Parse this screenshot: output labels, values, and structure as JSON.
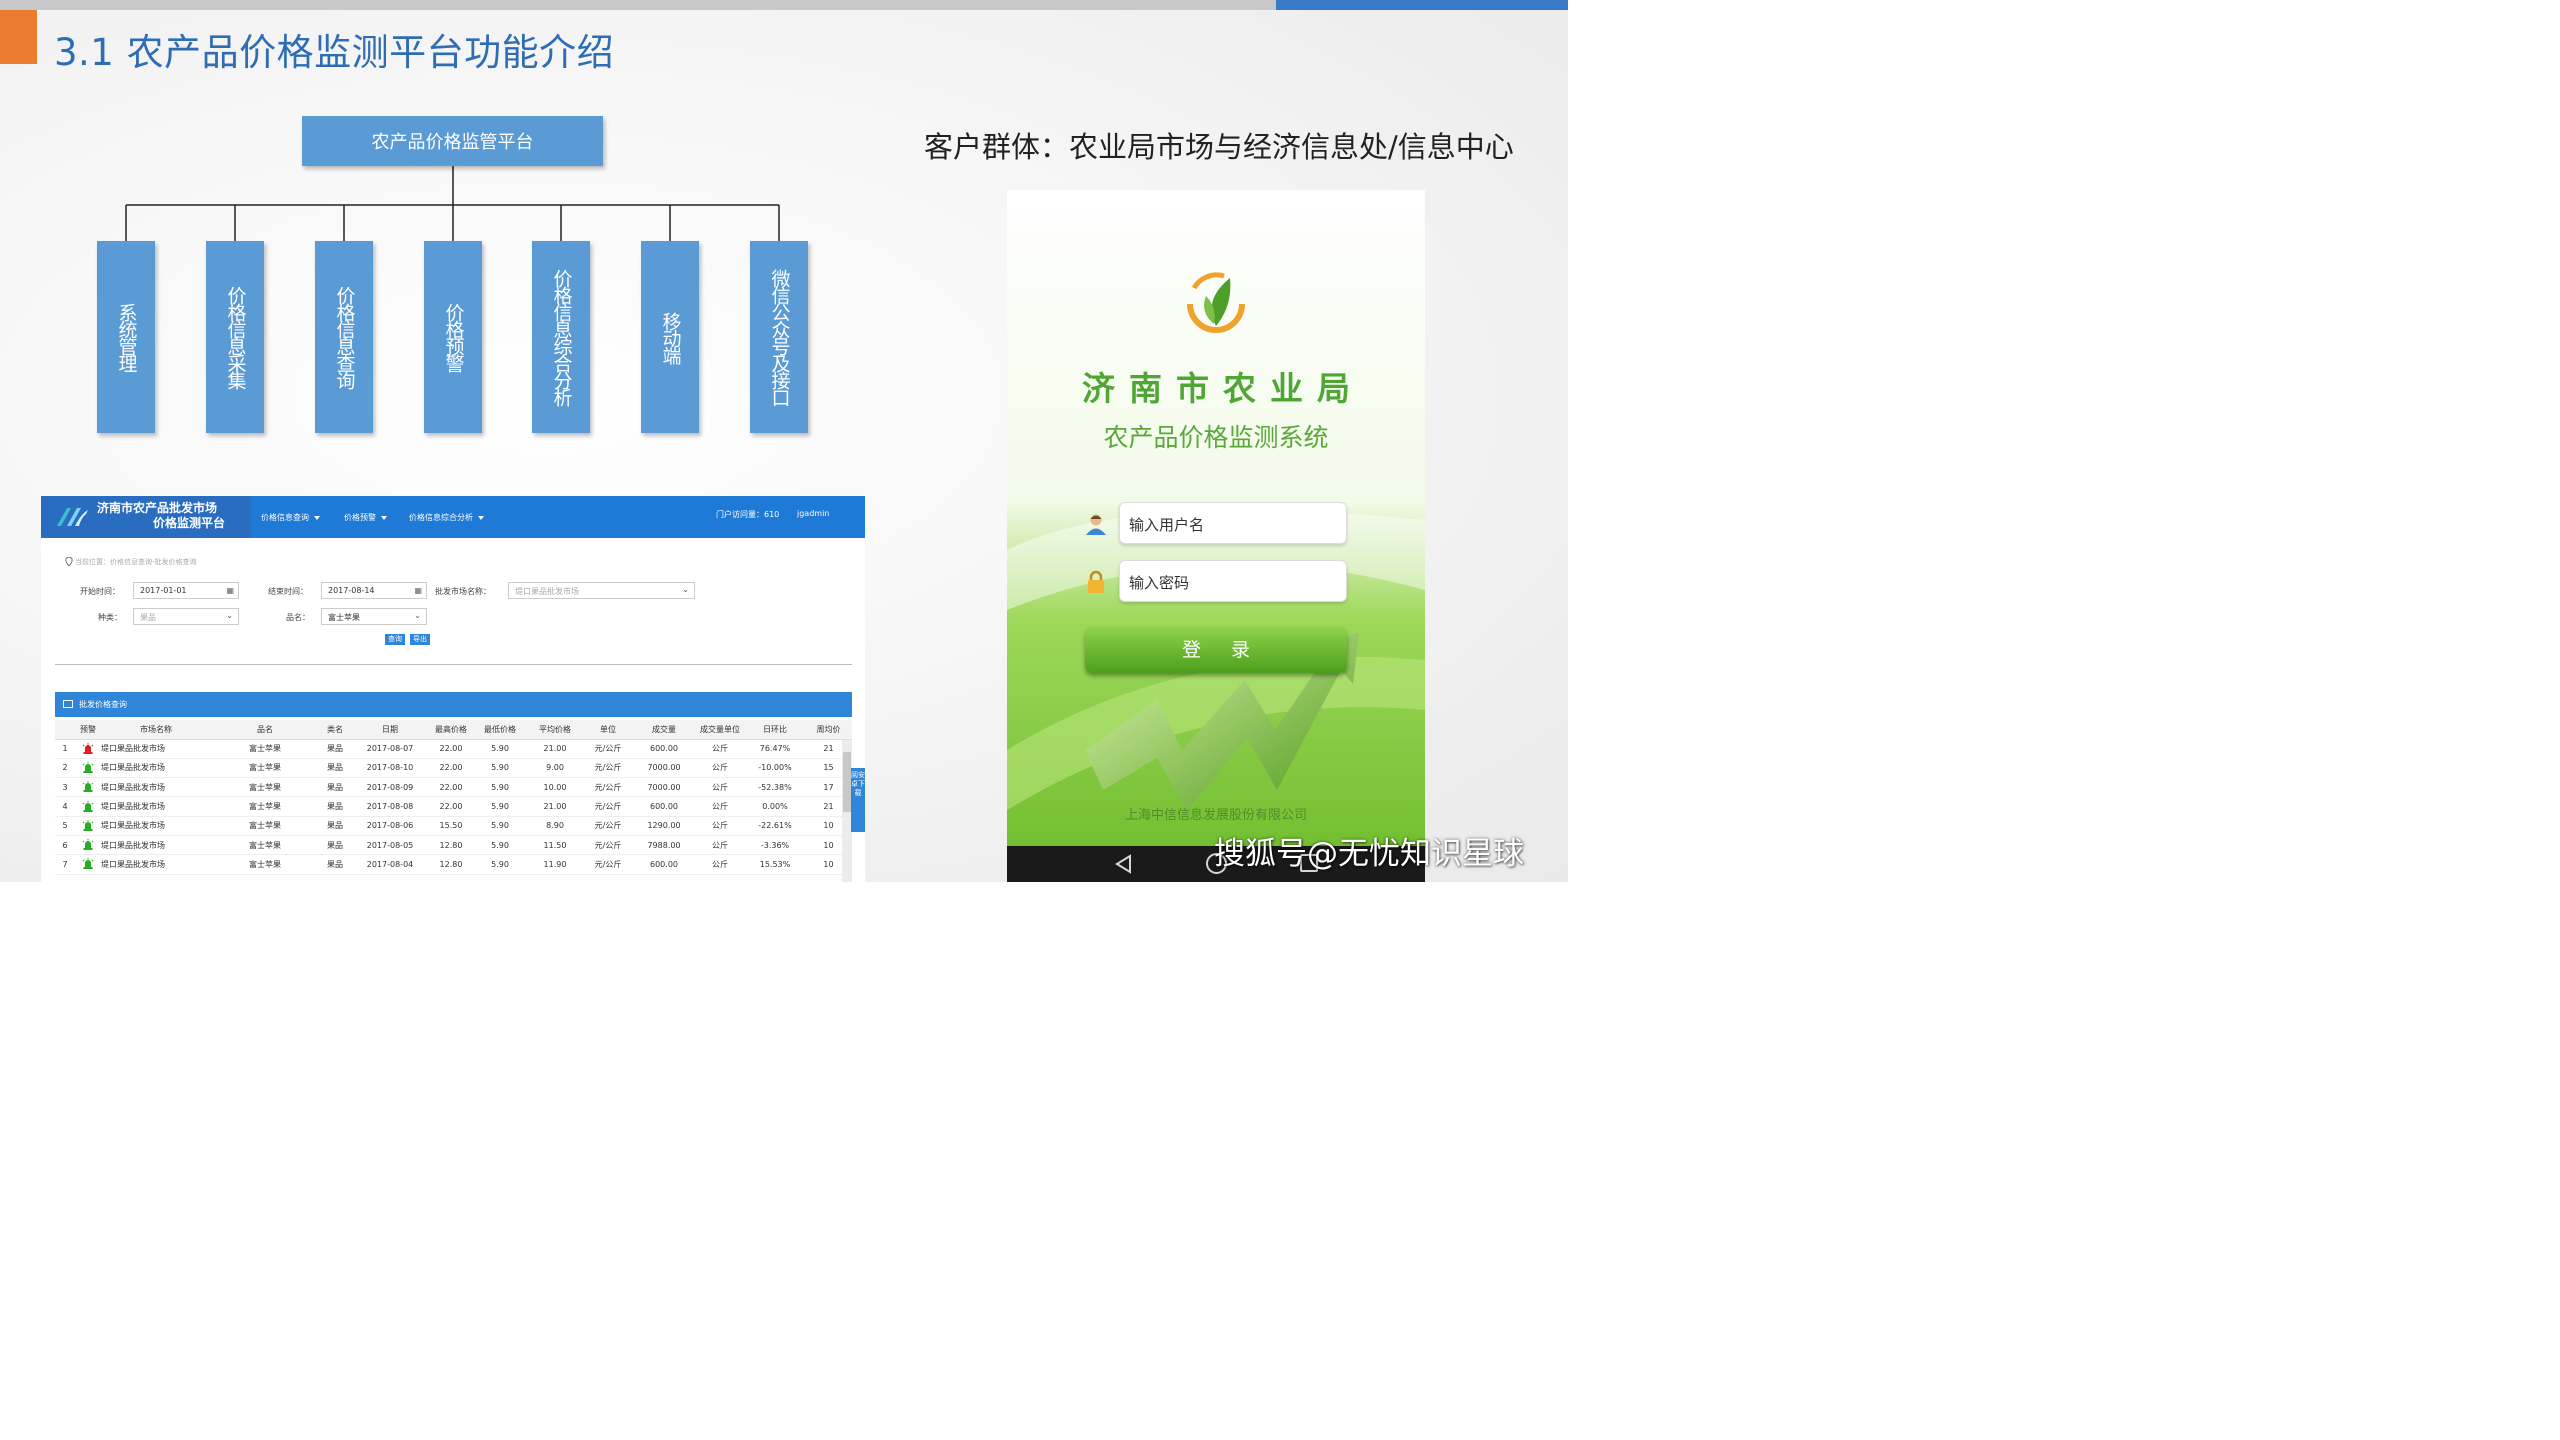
{
  "slide": {
    "title": "3.1 农产品价格监测平台功能介绍",
    "audience": "客户群体：农业局市场与经济信息处/信息中心",
    "watermark": "搜狐号@无忧知识星球",
    "colors": {
      "accent_orange": "#ec7c30",
      "title_blue": "#2e6db4",
      "box_blue": "#5b9bd5"
    }
  },
  "org_chart": {
    "root": "农产品价格监管平台",
    "children": [
      "系统管理",
      "价格信息采集",
      "价格信息查询",
      "价格预警",
      "价格信息综合分析",
      "移动端",
      "微信公众号及接口"
    ]
  },
  "web": {
    "site_title_line1": "济南市农产品批发市场",
    "site_title_line2": "价格监测平台",
    "nav": [
      "价格信息查询",
      "价格预警",
      "价格信息综合分析"
    ],
    "visits": "门户访问量：610",
    "user": "jgadmin",
    "breadcrumb": "当前位置：价格信息查询-批发价格查询",
    "filters": {
      "start_label": "开始时间：",
      "start_value": "2017-01-01",
      "end_label": "结束时间：",
      "end_value": "2017-08-14",
      "market_label": "批发市场名称：",
      "market_placeholder": "堤口果品批发市场",
      "kind_label": "种类：",
      "kind_value": "果品",
      "product_label": "品名：",
      "product_value": "富士苹果",
      "query_button": "查询",
      "export_button": "导出"
    },
    "panel_title": "批发价格查询",
    "columns": [
      "",
      "预警",
      "市场名称",
      "品名",
      "类名",
      "日期",
      "最高价格",
      "最低价格",
      "平均价格",
      "单位",
      "成交量",
      "成交量单位",
      "日环比",
      "周均价"
    ],
    "rows": [
      {
        "no": "1",
        "alert": "red",
        "market": "堤口果品批发市场",
        "product": "富士苹果",
        "category": "果品",
        "date": "2017-08-07",
        "high": "22.00",
        "low": "5.90",
        "avg": "21.00",
        "unit": "元/公斤",
        "volume": "600.00",
        "vol_unit": "公斤",
        "dod": "76.47%",
        "week": "21"
      },
      {
        "no": "2",
        "alert": "green",
        "market": "堤口果品批发市场",
        "product": "富士苹果",
        "category": "果品",
        "date": "2017-08-10",
        "high": "22.00",
        "low": "5.90",
        "avg": "9.00",
        "unit": "元/公斤",
        "volume": "7000.00",
        "vol_unit": "公斤",
        "dod": "-10.00%",
        "week": "15"
      },
      {
        "no": "3",
        "alert": "green",
        "market": "堤口果品批发市场",
        "product": "富士苹果",
        "category": "果品",
        "date": "2017-08-09",
        "high": "22.00",
        "low": "5.90",
        "avg": "10.00",
        "unit": "元/公斤",
        "volume": "7000.00",
        "vol_unit": "公斤",
        "dod": "-52.38%",
        "week": "17"
      },
      {
        "no": "4",
        "alert": "green",
        "market": "堤口果品批发市场",
        "product": "富士苹果",
        "category": "果品",
        "date": "2017-08-08",
        "high": "22.00",
        "low": "5.90",
        "avg": "21.00",
        "unit": "元/公斤",
        "volume": "600.00",
        "vol_unit": "公斤",
        "dod": "0.00%",
        "week": "21"
      },
      {
        "no": "5",
        "alert": "green",
        "market": "堤口果品批发市场",
        "product": "富士苹果",
        "category": "果品",
        "date": "2017-08-06",
        "high": "15.50",
        "low": "5.90",
        "avg": "8.90",
        "unit": "元/公斤",
        "volume": "1290.00",
        "vol_unit": "公斤",
        "dod": "-22.61%",
        "week": "10"
      },
      {
        "no": "6",
        "alert": "green",
        "market": "堤口果品批发市场",
        "product": "富士苹果",
        "category": "果品",
        "date": "2017-08-05",
        "high": "12.80",
        "low": "5.90",
        "avg": "11.50",
        "unit": "元/公斤",
        "volume": "7988.00",
        "vol_unit": "公斤",
        "dod": "-3.36%",
        "week": "10"
      },
      {
        "no": "7",
        "alert": "green",
        "market": "堤口果品批发市场",
        "product": "富士苹果",
        "category": "果品",
        "date": "2017-08-04",
        "high": "12.80",
        "low": "5.90",
        "avg": "11.90",
        "unit": "元/公斤",
        "volume": "600.00",
        "vol_unit": "公斤",
        "dod": "15.53%",
        "week": "10"
      }
    ],
    "side_tab": "阅安卓下载"
  },
  "phone": {
    "org_name": "济南市农业局",
    "system_name": "农产品价格监测系统",
    "username_placeholder": "输入用户名",
    "password_placeholder": "输入密码",
    "login_button": "登录",
    "company": "上海中信信息发展股份有限公司"
  }
}
